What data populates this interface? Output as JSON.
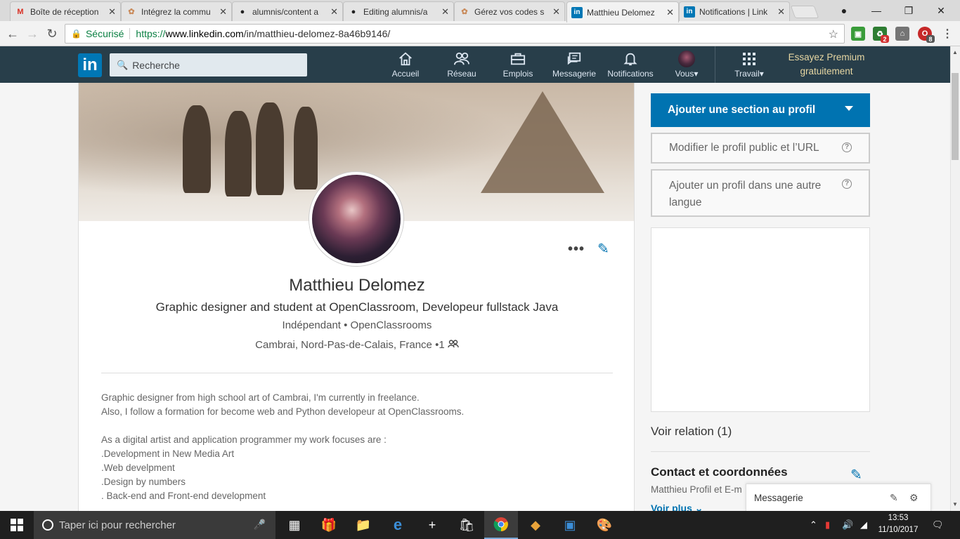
{
  "browser": {
    "tabs": [
      {
        "title": "Boîte de réception",
        "icon": "gmail-icon"
      },
      {
        "title": "Intégrez la commu",
        "icon": "openclassrooms-icon"
      },
      {
        "title": "alumnis/content a",
        "icon": "github-icon"
      },
      {
        "title": "Editing alumnis/a",
        "icon": "github-icon"
      },
      {
        "title": "Gérez vos codes s",
        "icon": "openclassrooms-icon"
      },
      {
        "title": "Matthieu Delomez",
        "icon": "linkedin-icon"
      },
      {
        "title": "Notifications | Link",
        "icon": "linkedin-icon"
      }
    ],
    "secure_label": "Sécurisé",
    "url_prefix": "https://",
    "url_domain": "www.linkedin.com",
    "url_path": "/in/matthieu-delomez-8a46b9146/",
    "ext_badges": [
      "2",
      "8"
    ]
  },
  "nav": {
    "search_placeholder": "Recherche",
    "items": [
      {
        "label": "Accueil",
        "icon": "home-icon"
      },
      {
        "label": "Réseau",
        "icon": "network-icon"
      },
      {
        "label": "Emplois",
        "icon": "briefcase-icon"
      },
      {
        "label": "Messagerie",
        "icon": "messaging-icon"
      },
      {
        "label": "Notifications",
        "icon": "bell-icon"
      },
      {
        "label": "Vous",
        "icon": "avatar-icon"
      },
      {
        "label": "Travail",
        "icon": "grid-icon"
      }
    ],
    "premium_line1": "Essayez Premium",
    "premium_line2": "gratuitement",
    "logo_text": "in"
  },
  "profile": {
    "name": "Matthieu Delomez",
    "headline": "Graphic designer and student at OpenClassroom, Developeur fullstack Java",
    "company": "Indépendant • OpenClassrooms",
    "location": "Cambrai, Nord-Pas-de-Calais, France",
    "connections": "•1",
    "summary": [
      "Graphic designer from high school art of Cambrai, I'm currently in freelance.",
      "Also, I follow a formation for become web and Python developeur at OpenClassrooms.",
      "",
      "As a digital artist and application programmer my work focuses are :",
      ".Development in New Media Art",
      ".Web develpment",
      ".Design by numbers",
      ". Back-end and Front-end development"
    ]
  },
  "sidebar": {
    "add_section": "Ajouter une section au profil",
    "edit_public": "Modifier le profil public et l’URL",
    "add_language_line1": "Ajouter un profil dans une autre",
    "add_language_line2": "langue",
    "relations": "Voir relation (1)",
    "contact_title": "Contact et coordonnées",
    "contact_sub": "Matthieu Profil et E-m",
    "see_more": "Voir plus"
  },
  "messaging": {
    "label": "Messagerie"
  },
  "taskbar": {
    "search_placeholder": "Taper ici pour rechercher",
    "time": "13:53",
    "date": "11/10/2017"
  },
  "colors": {
    "linkedin_blue": "#0073b1",
    "nav_bg": "#283e4a",
    "premium_gold": "#e7d7a3"
  }
}
